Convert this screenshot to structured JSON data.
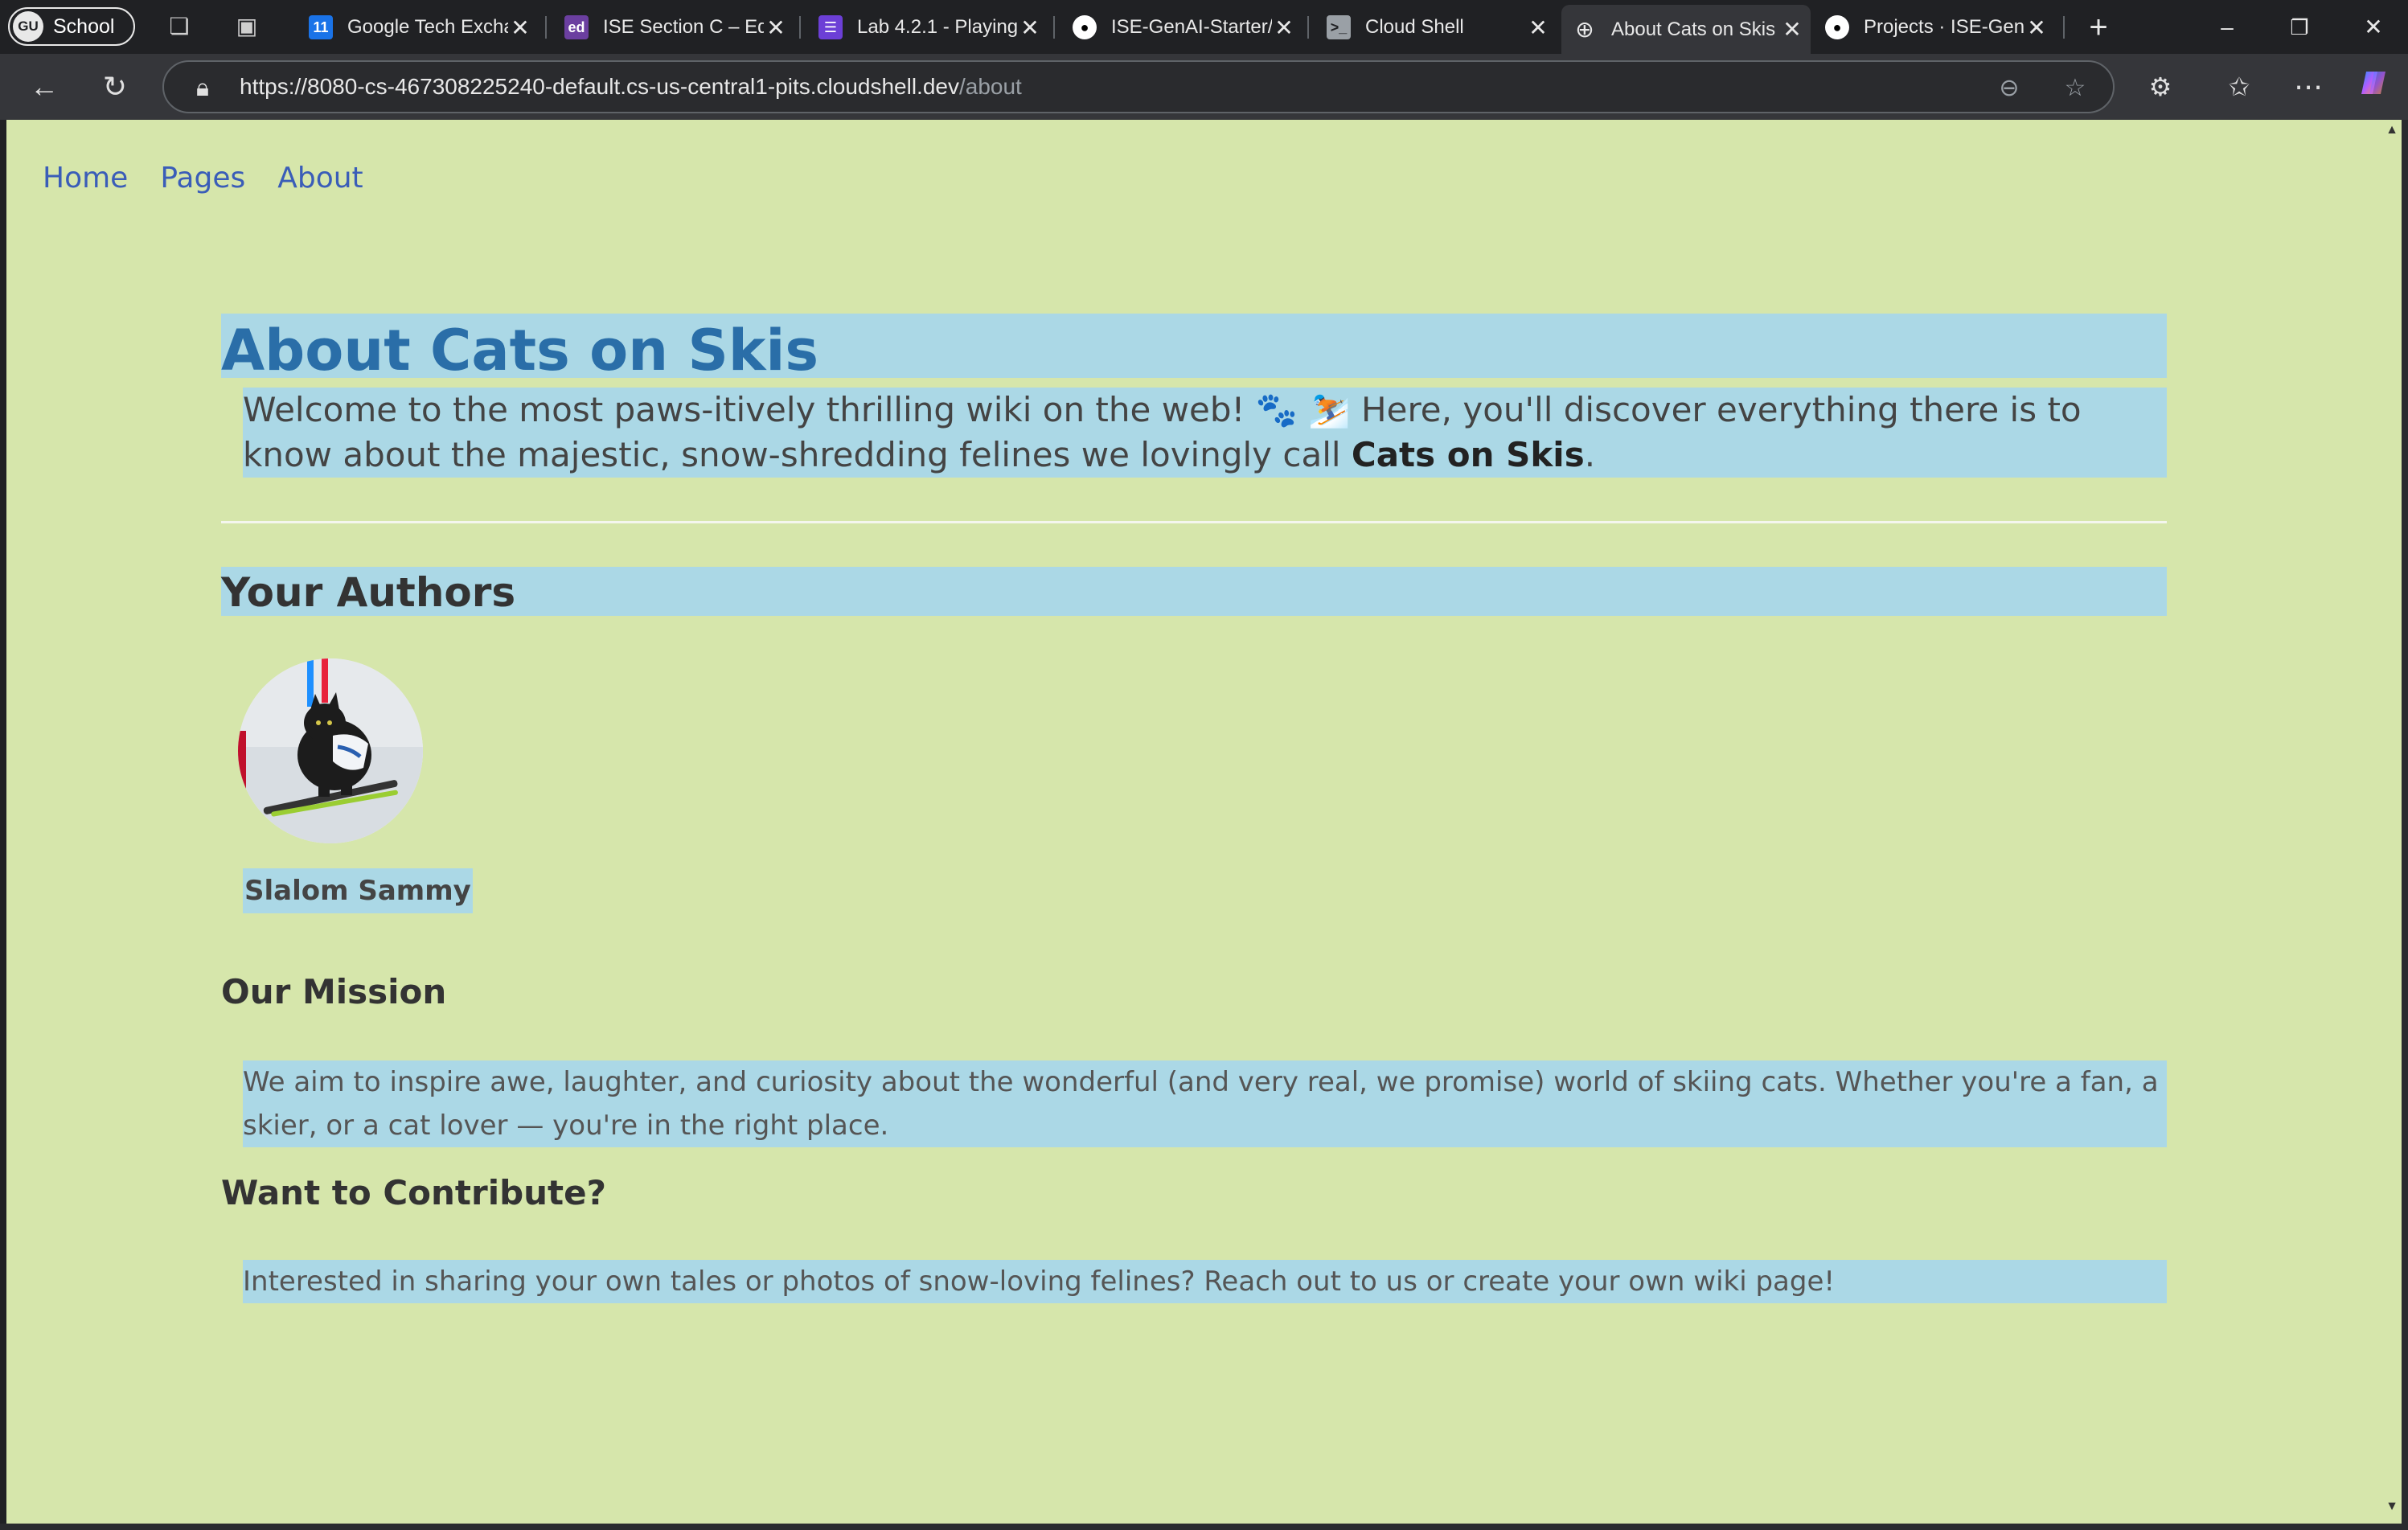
{
  "browser": {
    "profile": {
      "initials": "GU",
      "label": "School"
    },
    "tabs": [
      {
        "title": "Google Tech Exchange",
        "favicon": "calendar-11",
        "color": "#1a73e8"
      },
      {
        "title": "ISE Section C – Ed",
        "favicon": "ed",
        "color": "#6b3fa0"
      },
      {
        "title": "Lab 4.2.1 - Playing",
        "favicon": "list",
        "color": "#6c3fd6"
      },
      {
        "title": "ISE-GenAI-Starter/",
        "favicon": "github",
        "color": "#ffffff"
      },
      {
        "title": "Cloud Shell",
        "favicon": "terminal",
        "color": "#9aa0a6"
      },
      {
        "title": "About Cats on Skis",
        "favicon": "globe",
        "color": "#e8e8e8",
        "active": true
      },
      {
        "title": "Projects · ISE-GenAI",
        "favicon": "github",
        "color": "#ffffff"
      }
    ],
    "url_host": "https://8080-cs-467308225240-default.cs-us-central1-pits.cloudshell.dev",
    "url_path": "/about"
  },
  "nav": {
    "home": "Home",
    "pages": "Pages",
    "about": "About"
  },
  "page": {
    "title": "About Cats on Skis",
    "intro_1": "Welcome to the most paws-itively thrilling wiki on the web! 🐾 ⛷️  Here, you'll discover everything there is to know about the majestic, snow-shredding felines we lovingly call ",
    "intro_bold": "Cats on Skis",
    "intro_end": ".",
    "authors_heading": "Your Authors",
    "author_name": "Slalom Sammy",
    "mission_heading": "Our Mission",
    "mission_text": "We aim to inspire awe, laughter, and curiosity about the wonderful (and very real, we promise) world of skiing cats. Whether you're a fan, a skier, or a cat lover — you're in the right place.",
    "contribute_heading": "Want to Contribute?",
    "contribute_text": "Interested in sharing your own tales or photos of snow-loving felines? Reach out to us or create your own wiki page!"
  },
  "colors": {
    "page_bg": "#d6e6ab",
    "highlight": "#abd8e6",
    "title": "#2a6ea8",
    "link": "#3a5db8"
  }
}
